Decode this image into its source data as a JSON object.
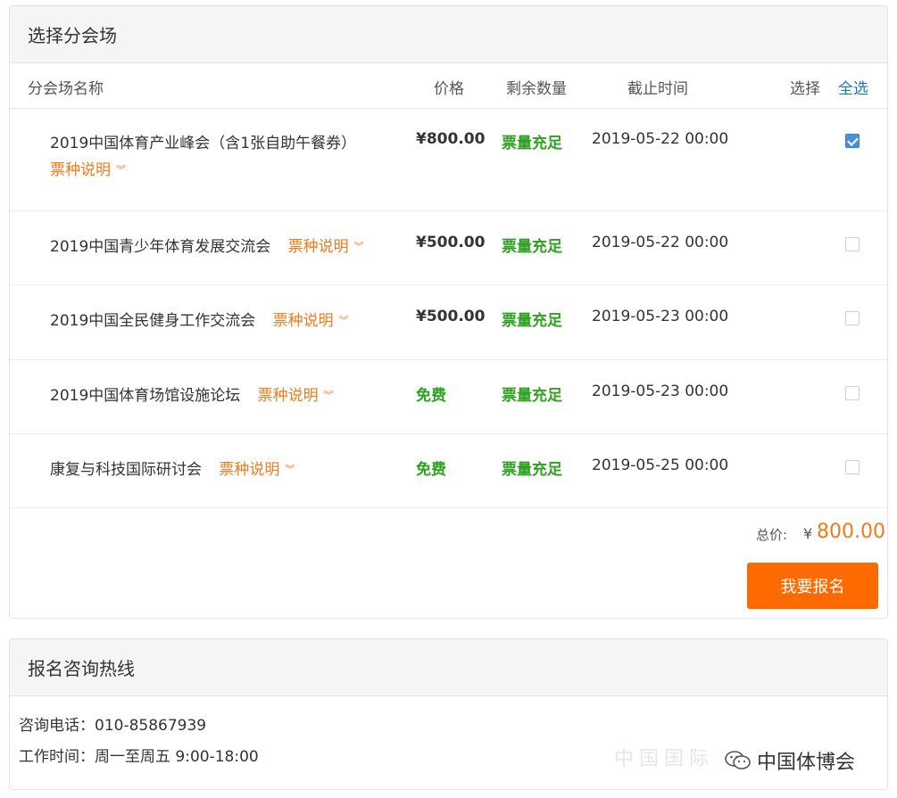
{
  "select_panel": {
    "title": "选择分会场",
    "headers": {
      "name": "分会场名称",
      "price": "价格",
      "remaining": "剩余数量",
      "deadline": "截止时间",
      "select": "选择",
      "select_all": "全选"
    },
    "note_label": "票种说明",
    "rows": [
      {
        "name": "2019中国体育产业峰会（含1张自助午餐券）",
        "price": "¥800.00",
        "remaining": "票量充足",
        "deadline": "2019-05-22 00:00",
        "checked": true
      },
      {
        "name": "2019中国青少年体育发展交流会",
        "price": "¥500.00",
        "remaining": "票量充足",
        "deadline": "2019-05-22 00:00",
        "checked": false
      },
      {
        "name": "2019中国全民健身工作交流会",
        "price": "¥500.00",
        "remaining": "票量充足",
        "deadline": "2019-05-23 00:00",
        "checked": false
      },
      {
        "name": "2019中国体育场馆设施论坛",
        "price": "免费",
        "remaining": "票量充足",
        "deadline": "2019-05-23 00:00",
        "checked": false
      },
      {
        "name": "康复与科技国际研讨会",
        "price": "免费",
        "remaining": "票量充足",
        "deadline": "2019-05-25 00:00",
        "checked": false
      }
    ],
    "total_label": "总价:",
    "total_currency": "¥",
    "total_value": "800.00",
    "register_button": "我要报名"
  },
  "contact_panel": {
    "title": "报名咨询热线",
    "phone": "咨询电话：010-85867939",
    "hours": "工作时间：周一至周五 9:00-18:00"
  },
  "watermark": {
    "faded_text": "中国国际",
    "account_name": "中国体博会",
    "icon": "wechat-icon"
  },
  "colors": {
    "accent_orange": "#ff6a00",
    "note_orange": "#f07a1c",
    "ok_green": "#2ea121",
    "link_blue": "#1e73be",
    "checkbox_blue": "#4a90d9"
  }
}
